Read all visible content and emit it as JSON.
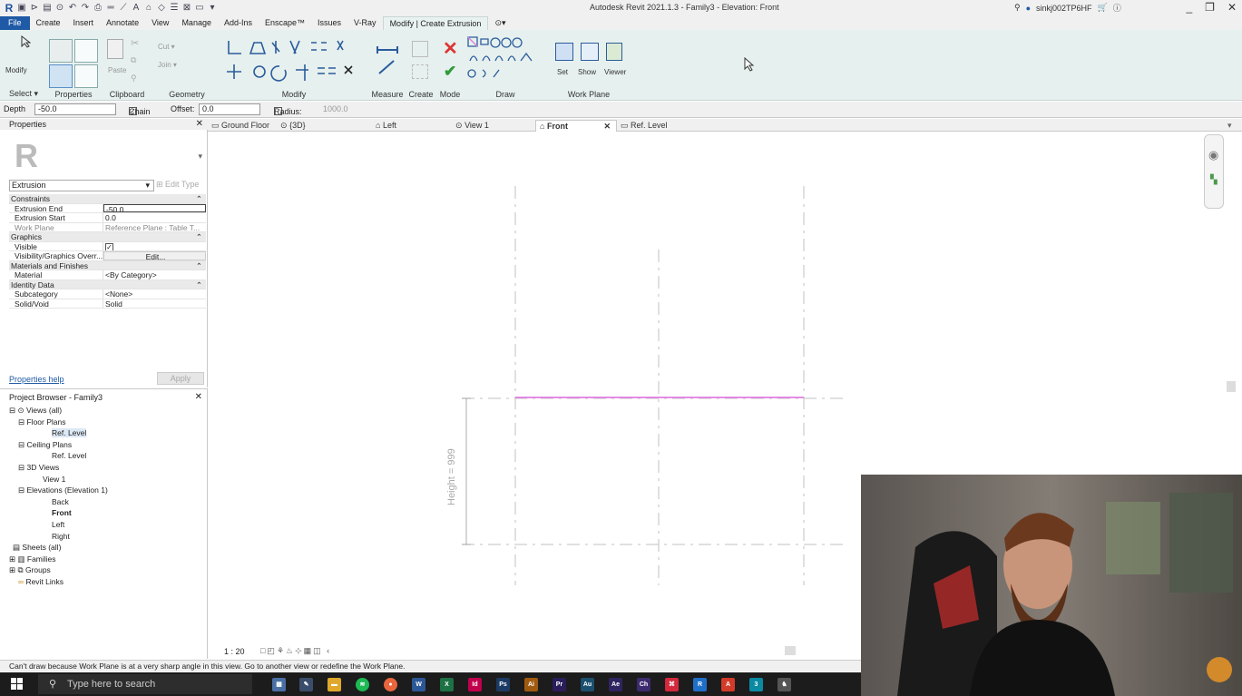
{
  "app": {
    "title": "Autodesk Revit 2021.1.3 - Family3 - Elevation: Front",
    "user": "sinkj002TP6HF"
  },
  "menu": {
    "tabs": [
      "File",
      "Create",
      "Insert",
      "Annotate",
      "View",
      "Manage",
      "Add-Ins",
      "Enscape™",
      "Issues",
      "V-Ray",
      "Modify | Create Extrusion"
    ]
  },
  "ribbon": {
    "modify_label": "Modify",
    "cut_label": "Cut",
    "join_label": "Join",
    "paste_label": "Paste",
    "set_label": "Set",
    "show_label": "Show",
    "viewer_label": "Viewer",
    "panels": [
      "Select ▾",
      "Properties",
      "Clipboard",
      "Geometry",
      "Modify",
      "Measure",
      "Create",
      "Mode",
      "Draw",
      "Work Plane"
    ]
  },
  "optionsbar": {
    "depth_label": "Depth",
    "depth_value": "-50.0",
    "chain_label": "Chain",
    "offset_label": "Offset:",
    "offset_value": "0.0",
    "radius_label": "Radius:",
    "radius_value": "1000.0"
  },
  "properties": {
    "title": "Properties",
    "instance": "Extrusion",
    "edit_type": "Edit Type",
    "categories": {
      "constraints": "Constraints",
      "graphics": "Graphics",
      "materials": "Materials and Finishes",
      "identity": "Identity Data"
    },
    "rows": {
      "ext_end_k": "Extrusion End",
      "ext_end_v": "-50.0",
      "ext_start_k": "Extrusion Start",
      "ext_start_v": "0.0",
      "work_plane_k": "Work Plane",
      "work_plane_v": "Reference Plane : Table T...",
      "visible_k": "Visible",
      "vis_graphics_k": "Visibility/Graphics Overr...",
      "vis_graphics_v": "Edit...",
      "material_k": "Material",
      "material_v": "<By Category>",
      "subcategory_k": "Subcategory",
      "subcategory_v": "<None>",
      "solid_void_k": "Solid/Void",
      "solid_void_v": "Solid"
    },
    "help_link": "Properties help",
    "apply": "Apply"
  },
  "browser": {
    "title": "Project Browser - Family3",
    "nodes": [
      "Views (all)",
      "Floor Plans",
      "Ref. Level",
      "Ceiling Plans",
      "Ref. Level",
      "3D Views",
      "View 1",
      "Elevations (Elevation 1)",
      "Back",
      "Front",
      "Left",
      "Right",
      "Sheets (all)",
      "Families",
      "Groups",
      "Revit Links"
    ]
  },
  "viewtabs": [
    "Ground Floor",
    "{3D}",
    "Left",
    "View 1",
    "Front",
    "Ref. Level"
  ],
  "canvas": {
    "dimension_label": "Height = 999"
  },
  "viewctrl": {
    "scale": "1 : 20"
  },
  "status": {
    "message": "Can't draw because Work Plane is at a very sharp angle in this view. Go to another view or redefine the Work Plane."
  },
  "taskbar": {
    "search_placeholder": "Type here to search"
  },
  "colors": {
    "accent": "#1f5aa6",
    "ribbon_bg": "#e6f0ee",
    "sketch_line": "#e07be0"
  }
}
